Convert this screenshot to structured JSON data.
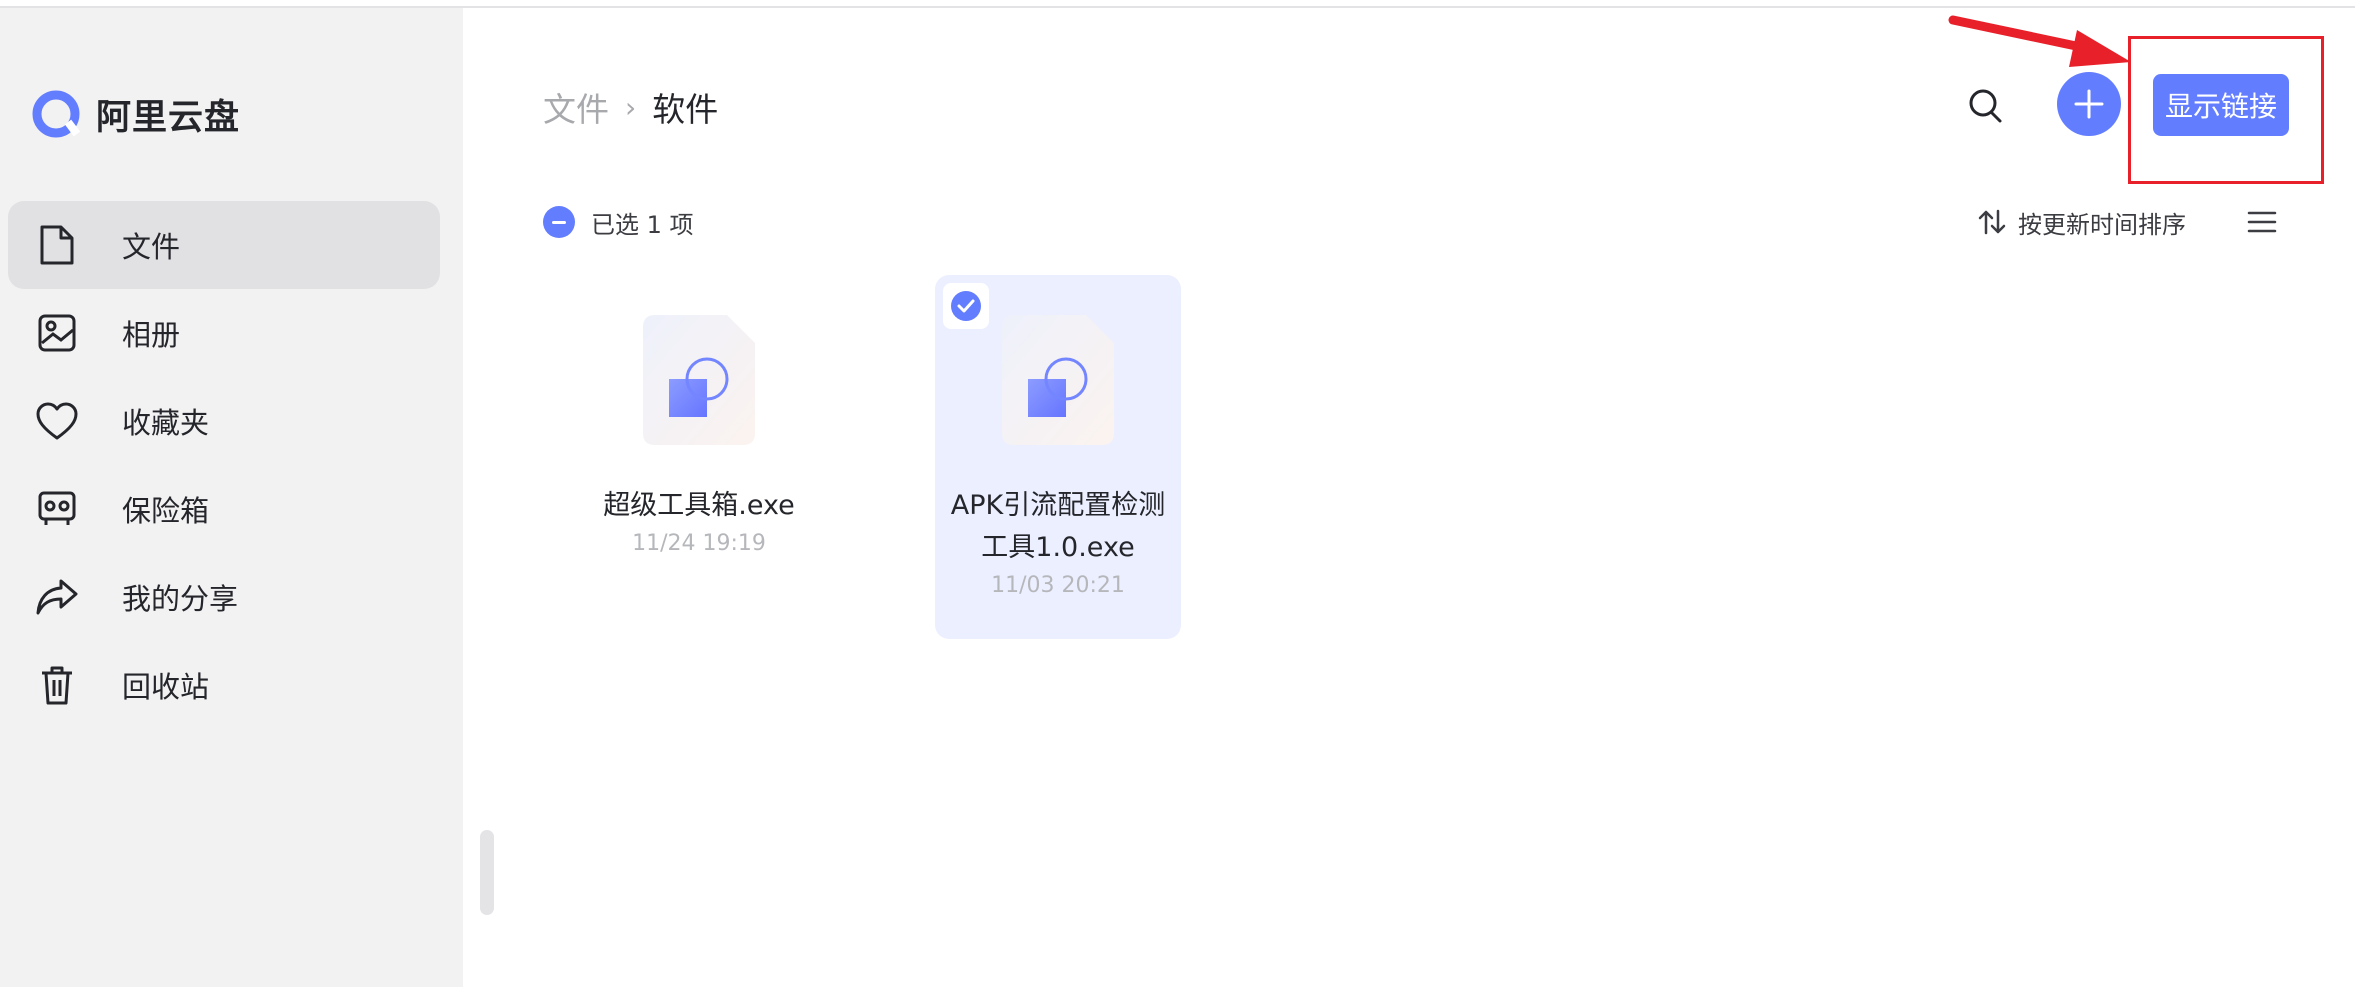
{
  "app": {
    "name": "阿里云盘"
  },
  "sidebar": {
    "items": [
      {
        "label": "文件",
        "icon": "file-icon",
        "active": true
      },
      {
        "label": "相册",
        "icon": "album-icon",
        "active": false
      },
      {
        "label": "收藏夹",
        "icon": "heart-icon",
        "active": false
      },
      {
        "label": "保险箱",
        "icon": "safe-icon",
        "active": false
      },
      {
        "label": "我的分享",
        "icon": "share-icon",
        "active": false
      },
      {
        "label": "回收站",
        "icon": "trash-icon",
        "active": false
      }
    ]
  },
  "header": {
    "breadcrumb": {
      "parent": "文件",
      "separator": "›",
      "current": "软件"
    },
    "show_link_label": "显示链接"
  },
  "toolbar": {
    "selection_text": "已选 1 项",
    "sort_label": "按更新时间排序"
  },
  "files": [
    {
      "name": "超级工具箱.exe",
      "time": "11/24 19:19",
      "selected": false
    },
    {
      "name": "APK引流配置检测工具1.0.exe",
      "time": "11/03 20:21",
      "selected": true
    }
  ],
  "colors": {
    "accent": "#637dff",
    "highlight": "#e8202a",
    "sidebar_bg": "#f2f2f3"
  }
}
